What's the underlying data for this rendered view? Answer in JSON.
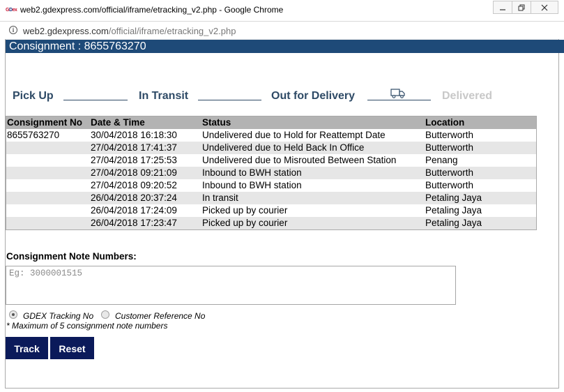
{
  "window": {
    "title": "web2.gdexpress.com/official/iframe/etracking_v2.php - Google Chrome",
    "favicon_text": "GDex"
  },
  "address_bar": {
    "host": "web2.gdexpress.com",
    "path": "/official/iframe/etracking_v2.php"
  },
  "consignment_header": "Consignment : 8655763270",
  "progress_steps": [
    {
      "label": "Pick Up",
      "active": true
    },
    {
      "label": "In Transit",
      "active": true
    },
    {
      "label": "Out for Delivery",
      "active": true
    },
    {
      "label": "Delivered",
      "active": false
    }
  ],
  "table": {
    "headers": [
      "Consignment No",
      "Date & Time",
      "Status",
      "Location"
    ],
    "rows": [
      [
        "8655763270",
        "30/04/2018 16:18:30",
        "Undelivered due to Hold for Reattempt Date",
        "Butterworth"
      ],
      [
        "",
        "27/04/2018 17:41:37",
        "Undelivered due to Held Back In Office",
        "Butterworth"
      ],
      [
        "",
        "27/04/2018 17:25:53",
        "Undelivered due to Misrouted Between Station",
        "Penang"
      ],
      [
        "",
        "27/04/2018 09:21:09",
        "Inbound to BWH station",
        "Butterworth"
      ],
      [
        "",
        "27/04/2018 09:20:52",
        "Inbound to BWH station",
        "Butterworth"
      ],
      [
        "",
        "26/04/2018 20:37:24",
        "In transit",
        "Petaling Jaya"
      ],
      [
        "",
        "26/04/2018 17:24:09",
        "Picked up by courier",
        "Petaling Jaya"
      ],
      [
        "",
        "26/04/2018 17:23:47",
        "Picked up by courier",
        "Petaling Jaya"
      ]
    ]
  },
  "form": {
    "label": "Consignment Note Numbers:",
    "placeholder": "Eg: 3000001515",
    "value": "",
    "radio_options": [
      {
        "label": "GDEX Tracking No",
        "selected": true
      },
      {
        "label": "Customer Reference No",
        "selected": false
      }
    ],
    "max_note": "* Maximum of 5 consignment note numbers",
    "track_label": "Track",
    "reset_label": "Reset"
  },
  "colors": {
    "header_bg": "#1e4a78",
    "step_active": "#2e4a66",
    "step_inactive": "#c8c8c8",
    "button_bg": "#0b1a5a",
    "table_header_bg": "#b3b3b3",
    "row_alt_bg": "#e6e6e6"
  }
}
